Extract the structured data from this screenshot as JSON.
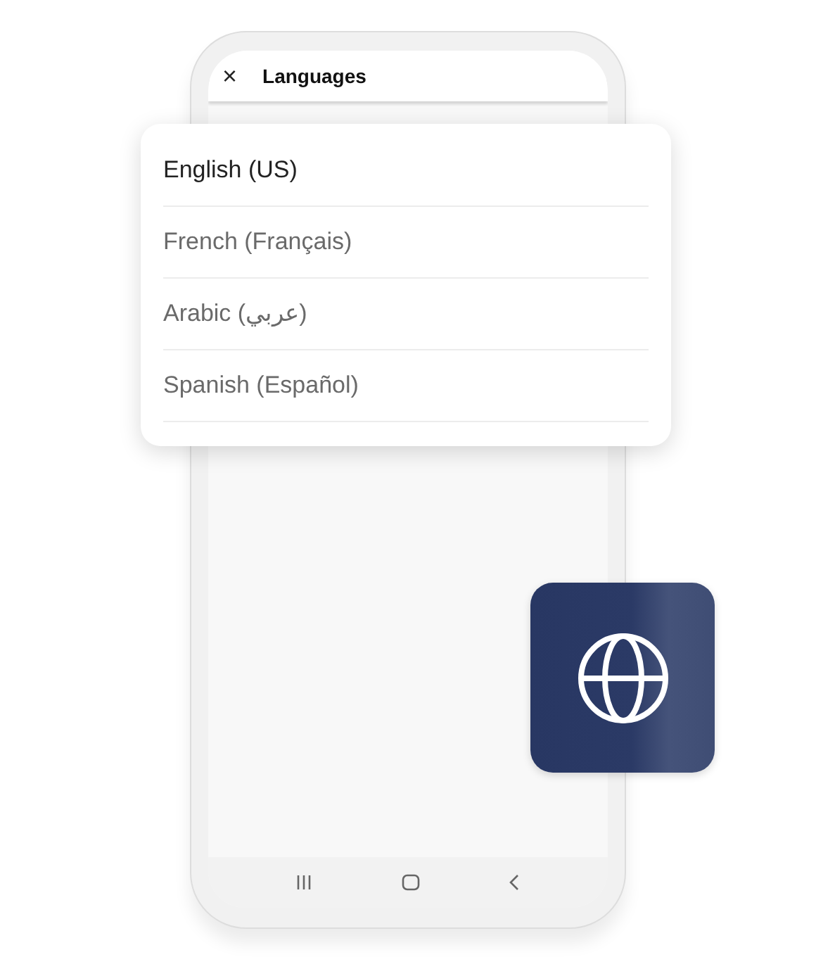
{
  "header": {
    "close": "×",
    "title": "Languages"
  },
  "languages": [
    {
      "label": "English (US)",
      "selected": true
    },
    {
      "label": "French (Français)",
      "selected": false
    },
    {
      "label": "Arabic (عربي)",
      "selected": false
    },
    {
      "label": "Spanish (Español)",
      "selected": false
    }
  ]
}
